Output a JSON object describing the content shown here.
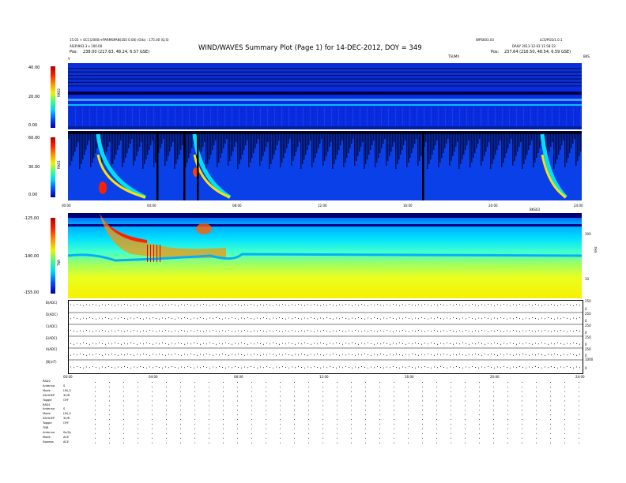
{
  "header": {
    "title": "WIND/WAVES Summary Plot (Page 1) for 14-DEC-2012, DOY = 349",
    "left_line1": "15.03 + ECC(2000)+PARMSPAN(350 0.00) (Orb) : 175.00 (Q,S)",
    "left_line2": "AS(P)963.3 x 100.00",
    "left_line3_label": "Pos:",
    "left_line3_value": "238.00 (217.63, 48.24, 6.57 GSE)",
    "center_right_label": "TSUMX",
    "right_top": "WPS603.03",
    "right_top2": "LCS/PGS/1.0.1",
    "right_line2": "DAILY 2013-12-03 11:58:33",
    "right_line3_label": "Pos:",
    "right_line3_value": "237.64 (216.50, 48.54, 6.59 GSE)",
    "left_corner_label": "V",
    "right_corner_label": "BKS"
  },
  "chart_data": [
    {
      "type": "heatmap",
      "name": "RAD2",
      "ylabel": "RAD2",
      "yticks": [
        "40.00",
        "20.00",
        "0.00"
      ],
      "ylim": [
        0,
        40
      ],
      "x_range_hours": [
        0,
        24
      ]
    },
    {
      "type": "heatmap",
      "name": "RAD1",
      "ylabel": "RAD1",
      "yticks": [
        "60.00",
        "30.00",
        "0.00"
      ],
      "ylim": [
        0,
        60
      ],
      "x_range_hours": [
        0,
        24
      ],
      "xticks": [
        "00:00",
        "04:00",
        "08:00",
        "12:00",
        "16:00",
        "20:00",
        "24:00"
      ]
    },
    {
      "type": "heatmap",
      "name": "TNR",
      "ylabel": "TNR",
      "yticks": [
        "-125.00",
        "-140.00",
        "-155.00"
      ],
      "right_ticks": [
        "100",
        "10"
      ],
      "right_label": "kHz",
      "top_right_label": "BKS03"
    },
    {
      "type": "line",
      "name": "housekeeping",
      "rows": [
        {
          "label": "B(ADC)",
          "right_ticks": [
            "250",
            "0"
          ]
        },
        {
          "label": "D(ADC)",
          "right_ticks": [
            "250",
            "0"
          ]
        },
        {
          "label": "C(ADC)",
          "right_ticks": [
            "250",
            "0"
          ]
        },
        {
          "label": "E(ADC)",
          "right_ticks": [
            "250",
            "0"
          ]
        },
        {
          "label": "A(ADC)",
          "right_ticks": [
            "250",
            "0"
          ]
        },
        {
          "label": "|B|(nT)",
          "right_ticks": [
            "1000",
            "0"
          ]
        }
      ],
      "xticks": [
        "00:00",
        "04:00",
        "08:00",
        "12:00",
        "16:00",
        "20:00",
        "24:00"
      ]
    }
  ],
  "modes": [
    {
      "label": "RAD2",
      "value": ""
    },
    {
      "label": "Antenna",
      "value": "S"
    },
    {
      "label": "Mode",
      "value": "LIN_S"
    },
    {
      "label": "S&HOEP",
      "value": "32/R"
    },
    {
      "label": "Toggle",
      "value": "OFF"
    },
    {
      "label": "RAD1",
      "value": ""
    },
    {
      "label": "Antenna",
      "value": "S"
    },
    {
      "label": "Mode",
      "value": "LIN_S"
    },
    {
      "label": "S&HOEP",
      "value": "32/R"
    },
    {
      "label": "Toggle",
      "value": "OFF"
    },
    {
      "label": "TNR",
      "value": ""
    },
    {
      "label": "Antenna",
      "value": "Sx/Sy"
    },
    {
      "label": "Mode",
      "value": "ACE"
    },
    {
      "label": "Sweeps",
      "value": "ACE"
    }
  ],
  "colors": {
    "background_spectrum": "#0a2ce0",
    "dark_band": "#000050",
    "burst": "#ff0000"
  }
}
